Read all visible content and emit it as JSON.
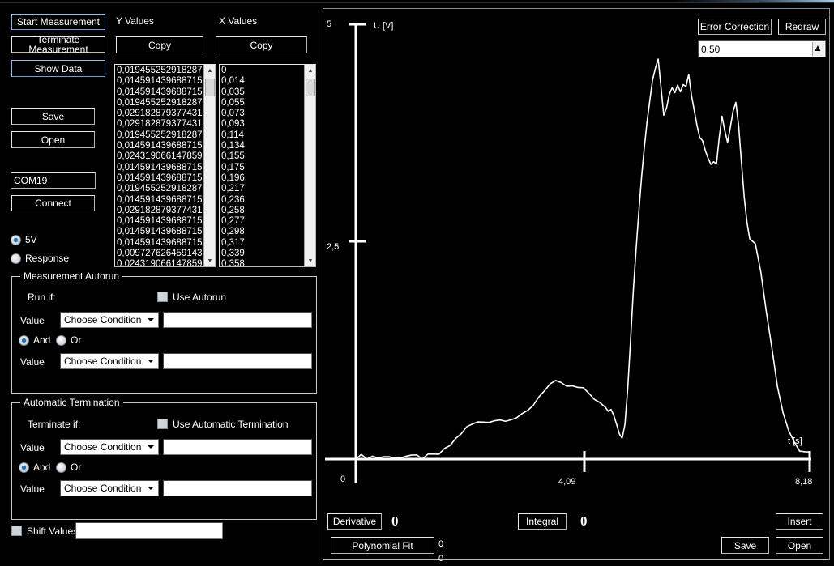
{
  "left_panel": {
    "buttons": {
      "start": "Start Measurement",
      "terminate": "Terminate Measurement",
      "show_data": "Show Data",
      "save": "Save",
      "open": "Open",
      "connect": "Connect"
    },
    "com_port_value": "COM19",
    "mode_radios": [
      {
        "label": "5V",
        "selected": true
      },
      {
        "label": "Response",
        "selected": false
      }
    ]
  },
  "data_lists": {
    "y_header": "Y Values",
    "x_header": "X Values",
    "y_copy_label": "Copy",
    "x_copy_label": "Copy",
    "y_values": [
      "0,019455252918287",
      "0,014591439688715",
      "0,014591439688715",
      "0,019455252918287",
      "0,029182879377431",
      "0,029182879377431",
      "0,019455252918287",
      "0,014591439688715",
      "0,024319066147859",
      "0,014591439688715",
      "0,014591439688715",
      "0,019455252918287",
      "0,014591439688715",
      "0,029182879377431",
      "0,014591439688715",
      "0,014591439688715",
      "0,014591439688715",
      "0,009727626459143",
      "0,024319066147859"
    ],
    "x_values": [
      "0",
      "0,014",
      "0,035",
      "0,055",
      "0,073",
      "0,093",
      "0,114",
      "0,134",
      "0,155",
      "0,175",
      "0,196",
      "0,217",
      "0,236",
      "0,258",
      "0,277",
      "0,298",
      "0,317",
      "0,339",
      "0,358"
    ]
  },
  "autorun": {
    "title": "Measurement Autorun",
    "run_if_label": "Run if:",
    "use_autorun_label": "Use Autorun",
    "use_autorun_checked": false,
    "value_label_1": "Value",
    "condition_1": "Choose Condition",
    "value_text_1": "",
    "and_label": "And",
    "or_label": "Or",
    "and_selected": true,
    "value_label_2": "Value",
    "condition_2": "Choose Condition",
    "value_text_2": ""
  },
  "termination": {
    "title": "Automatic Termination",
    "terminate_if_label": "Terminate if:",
    "use_auto_term_label": "Use Automatic Termination",
    "use_auto_term_checked": false,
    "value_label_1": "Value",
    "condition_1": "Choose Condition",
    "value_text_1": "",
    "and_label": "And",
    "or_label": "Or",
    "and_selected": true,
    "value_label_2": "Value",
    "condition_2": "Choose Condition",
    "value_text_2": ""
  },
  "shift": {
    "label": "Shift Values",
    "checked": false,
    "value": ""
  },
  "chart_toolbar": {
    "error_correction": "Error Correction",
    "redraw": "Redraw",
    "spinner_value": "0,50"
  },
  "chart_bottom": {
    "derivative_label": "Derivative",
    "derivative_value": "0",
    "integral_label": "Integral",
    "integral_value": "0",
    "polynomial_label": "Polynomial Fit",
    "poly_value_1": "0",
    "poly_value_2": "0",
    "insert_label": "Insert",
    "save_label": "Save",
    "open_label": "Open"
  },
  "chart_data": {
    "type": "line",
    "title": "",
    "xlabel": "t [s]",
    "ylabel": "U [V]",
    "xlim": [
      0,
      8.18
    ],
    "ylim": [
      0,
      5
    ],
    "xticks": [
      "0",
      "4,09",
      "8,18"
    ],
    "yticks": [
      "0",
      "2,5",
      "5"
    ],
    "grid": false,
    "legend": "none",
    "series": [
      {
        "name": "U",
        "color": "#ffffff",
        "x": [
          0.0,
          0.1,
          0.2,
          0.3,
          0.4,
          0.5,
          0.6,
          0.7,
          0.8,
          0.9,
          1.0,
          1.1,
          1.2,
          1.3,
          1.4,
          1.5,
          1.6,
          1.7,
          1.8,
          1.9,
          2.0,
          2.1,
          2.2,
          2.3,
          2.4,
          2.5,
          2.6,
          2.7,
          2.8,
          2.9,
          3.0,
          3.1,
          3.2,
          3.3,
          3.4,
          3.5,
          3.6,
          3.7,
          3.8,
          3.9,
          4.0,
          4.1,
          4.2,
          4.3,
          4.4,
          4.5,
          4.55,
          4.6,
          4.65,
          4.7,
          4.75,
          4.8,
          4.85,
          4.9,
          4.95,
          5.0,
          5.05,
          5.1,
          5.15,
          5.2,
          5.25,
          5.3,
          5.35,
          5.4,
          5.45,
          5.5,
          5.55,
          5.6,
          5.65,
          5.7,
          5.75,
          5.8,
          5.85,
          5.9,
          5.95,
          6.0,
          6.05,
          6.1,
          6.15,
          6.2,
          6.25,
          6.3,
          6.35,
          6.4,
          6.45,
          6.5,
          6.55,
          6.6,
          6.65,
          6.7,
          6.75,
          6.8,
          6.85,
          6.9,
          6.95,
          7.0,
          7.05,
          7.1,
          7.2,
          7.3,
          7.4,
          7.5,
          7.6,
          7.7,
          7.8,
          7.9,
          8.0,
          8.1,
          8.18
        ],
        "y": [
          0.02,
          0.03,
          0.02,
          0.03,
          0.02,
          0.03,
          0.02,
          0.03,
          0.02,
          0.03,
          0.02,
          0.03,
          0.02,
          0.03,
          0.04,
          0.06,
          0.1,
          0.16,
          0.23,
          0.3,
          0.36,
          0.4,
          0.42,
          0.43,
          0.44,
          0.45,
          0.45,
          0.46,
          0.47,
          0.48,
          0.5,
          0.55,
          0.63,
          0.72,
          0.8,
          0.86,
          0.88,
          0.86,
          0.84,
          0.83,
          0.82,
          0.8,
          0.76,
          0.7,
          0.64,
          0.58,
          0.56,
          0.57,
          0.52,
          0.42,
          0.3,
          0.26,
          0.38,
          0.8,
          1.35,
          1.9,
          2.4,
          2.85,
          3.25,
          3.6,
          3.9,
          4.15,
          4.35,
          4.52,
          4.62,
          4.3,
          3.95,
          4.05,
          4.2,
          4.28,
          4.22,
          4.3,
          4.24,
          4.33,
          4.3,
          4.42,
          4.2,
          4.0,
          3.85,
          3.72,
          3.65,
          3.55,
          3.48,
          3.4,
          3.44,
          3.4,
          3.7,
          3.95,
          3.78,
          3.62,
          3.8,
          4.02,
          4.1,
          3.82,
          3.4,
          3.0,
          2.7,
          2.55,
          2.5,
          2.15,
          1.7,
          1.25,
          0.85,
          0.55,
          0.33,
          0.18,
          0.1,
          0.08,
          0.07
        ]
      }
    ]
  }
}
